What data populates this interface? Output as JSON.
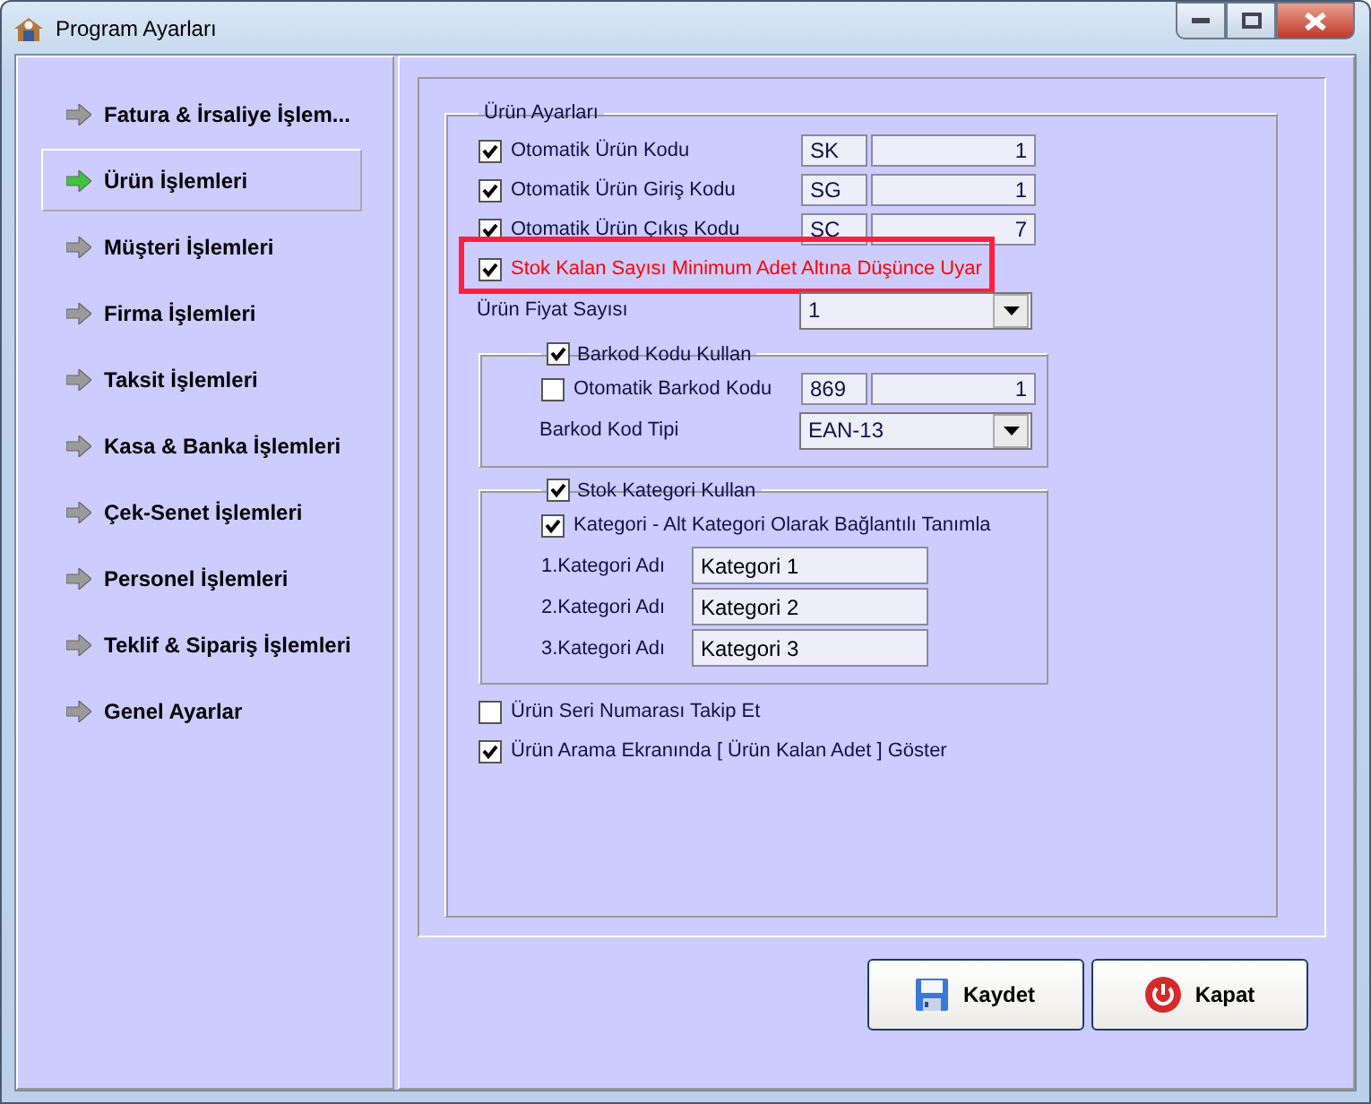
{
  "window": {
    "title": "Program Ayarları"
  },
  "sidebar": {
    "items": [
      {
        "label": "Fatura & İrsaliye İşlem...",
        "selected": false
      },
      {
        "label": "Ürün İşlemleri",
        "selected": true
      },
      {
        "label": "Müşteri İşlemleri",
        "selected": false
      },
      {
        "label": "Firma İşlemleri",
        "selected": false
      },
      {
        "label": "Taksit İşlemleri",
        "selected": false
      },
      {
        "label": "Kasa & Banka İşlemleri",
        "selected": false
      },
      {
        "label": "Çek-Senet İşlemleri",
        "selected": false
      },
      {
        "label": "Personel İşlemleri",
        "selected": false
      },
      {
        "label": "Teklif & Sipariş İşlemleri",
        "selected": false
      },
      {
        "label": "Genel Ayarlar",
        "selected": false
      }
    ]
  },
  "product_settings": {
    "title": "Ürün Ayarları",
    "options": [
      {
        "kind": "code",
        "label": "Otomatik Ürün Kodu",
        "checked": true,
        "prefix": "SK",
        "number": "1"
      },
      {
        "kind": "code",
        "label": "Otomatik Ürün Giriş Kodu",
        "checked": true,
        "prefix": "SG",
        "number": "1"
      },
      {
        "kind": "code",
        "label": "Otomatik Ürün Çıkış Kodu",
        "checked": true,
        "prefix": "SC",
        "number": "7"
      },
      {
        "kind": "check",
        "label": "Stok Kalan Sayısı Minimum Adet Altına Düşünce Uyar",
        "checked": true,
        "highlighted": true
      },
      {
        "kind": "select",
        "label": "Ürün Fiyat Sayısı",
        "value": "1"
      },
      {
        "kind": "group",
        "label": "Barkod Kodu Kullan",
        "checked": true,
        "children": [
          {
            "kind": "code",
            "label": "Otomatik Barkod Kodu",
            "checked": false,
            "prefix": "869",
            "number": "1"
          },
          {
            "kind": "select",
            "label": "Barkod Kod Tipi",
            "value": "EAN-13"
          }
        ]
      },
      {
        "kind": "group",
        "label": "Stok Kategori Kullan",
        "checked": true,
        "children": [
          {
            "kind": "check",
            "label": "Kategori - Alt Kategori Olarak Bağlantılı Tanımla",
            "checked": true,
            "highlighted": false
          },
          {
            "kind": "text",
            "label": "1.Kategori Adı",
            "value": "Kategori 1"
          },
          {
            "kind": "text",
            "label": "2.Kategori Adı",
            "value": "Kategori 2"
          },
          {
            "kind": "text",
            "label": "3.Kategori Adı",
            "value": "Kategori 3"
          }
        ]
      },
      {
        "kind": "check",
        "label": "Ürün Seri Numarası Takip Et",
        "checked": false,
        "highlighted": false
      },
      {
        "kind": "check",
        "label": "Ürün Arama Ekranında [ Ürün Kalan Adet ] Göster",
        "checked": true,
        "highlighted": false
      }
    ]
  },
  "buttons": [
    {
      "kind": "save",
      "label": "Kaydet"
    },
    {
      "kind": "close",
      "label": "Kapat"
    }
  ]
}
